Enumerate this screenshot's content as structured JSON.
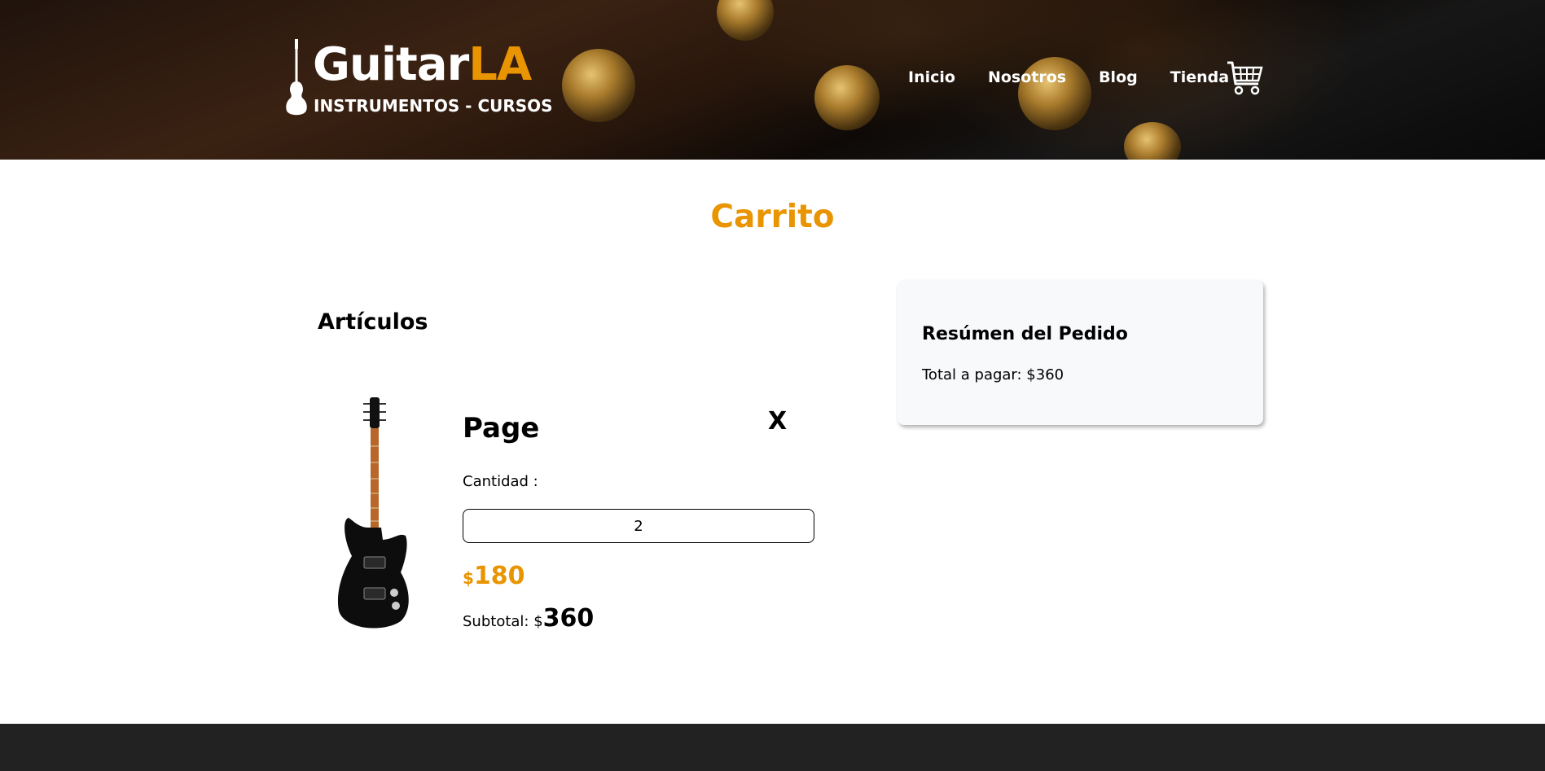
{
  "header": {
    "logo": {
      "brand_main": "Guitar",
      "brand_accent": "LA",
      "tagline": "INSTRUMENTOS - CURSOS"
    },
    "nav": [
      {
        "label": "Inicio"
      },
      {
        "label": "Nosotros"
      },
      {
        "label": "Blog"
      },
      {
        "label": "Tienda"
      }
    ],
    "cart_icon": "shopping-cart-icon"
  },
  "main": {
    "title": "Carrito",
    "articles_heading": "Artículos",
    "items": [
      {
        "name": "Page",
        "remove_label": "X",
        "quantity_label": "Cantidad :",
        "quantity": "2",
        "price_currency": "$",
        "price": "180",
        "subtotal_label": "Subtotal: $",
        "subtotal": "360"
      }
    ],
    "summary": {
      "title": "Resúmen del Pedido",
      "total": "Total a pagar: $360"
    }
  },
  "colors": {
    "accent": "#e99401",
    "footer": "#222222",
    "summary_bg": "#f8f9fb"
  }
}
